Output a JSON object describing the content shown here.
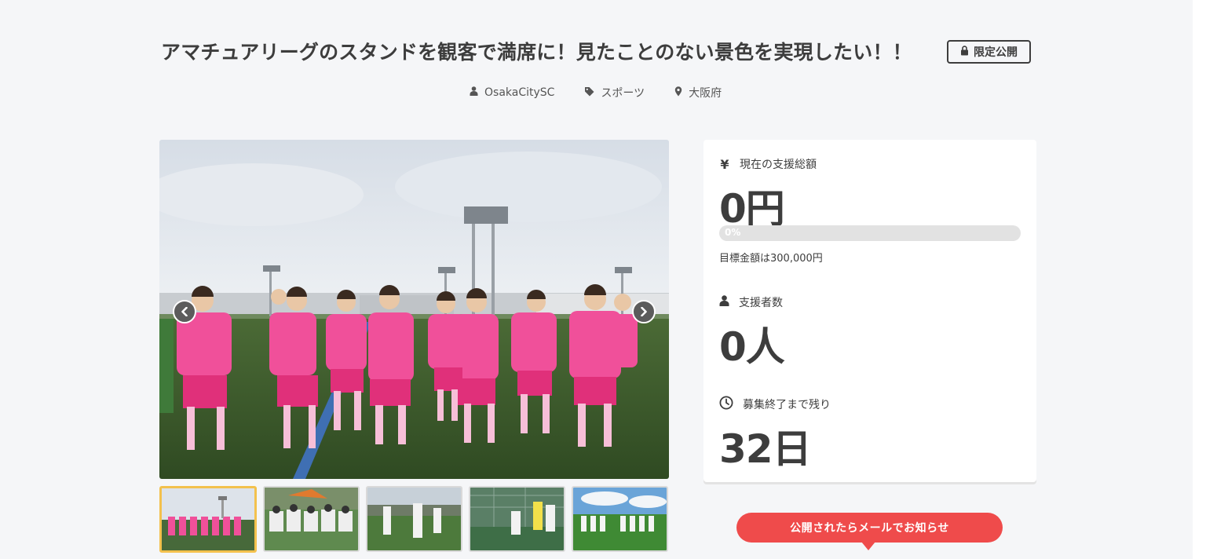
{
  "project": {
    "title": "アマチュアリーグのスタンドを観客で満席に！見たことのない景色を実現したい！！",
    "badge_label": "限定公開",
    "badge_icon": "lock-icon",
    "owner": "OsakaCitySC",
    "owner_icon": "user-icon",
    "category": "スポーツ",
    "category_icon": "tag-icon",
    "location": "大阪府",
    "location_icon": "map-pin-icon"
  },
  "gallery": {
    "main_image": "team-photo-pink-uniforms",
    "prev_icon": "chevron-left-icon",
    "next_icon": "chevron-right-icon",
    "thumbnails": [
      {
        "name": "team-lineup-pink",
        "active": true
      },
      {
        "name": "team-huddle-white",
        "active": false
      },
      {
        "name": "players-on-pitch",
        "active": false
      },
      {
        "name": "goalmouth-scramble",
        "active": false
      },
      {
        "name": "team-lineup-white",
        "active": false
      }
    ]
  },
  "stats": {
    "total": {
      "icon": "yen-icon",
      "label": "現在の支援総額",
      "value": "0円",
      "progress_text": "0%",
      "progress_percent": 0,
      "goal_text": "目標金額は300,000円"
    },
    "supporters": {
      "icon": "person-icon",
      "label": "支援者数",
      "value": "0人"
    },
    "remaining": {
      "icon": "clock-icon",
      "label": "募集終了まで残り",
      "value": "32日"
    }
  },
  "actions": {
    "notify_label": "公開されたらメールでお知らせ"
  },
  "colors": {
    "accent_red": "#ef4b4b",
    "active_thumb_border": "#f3c14d",
    "text_dark": "#3d3d3d",
    "background": "#f5f6f8"
  }
}
